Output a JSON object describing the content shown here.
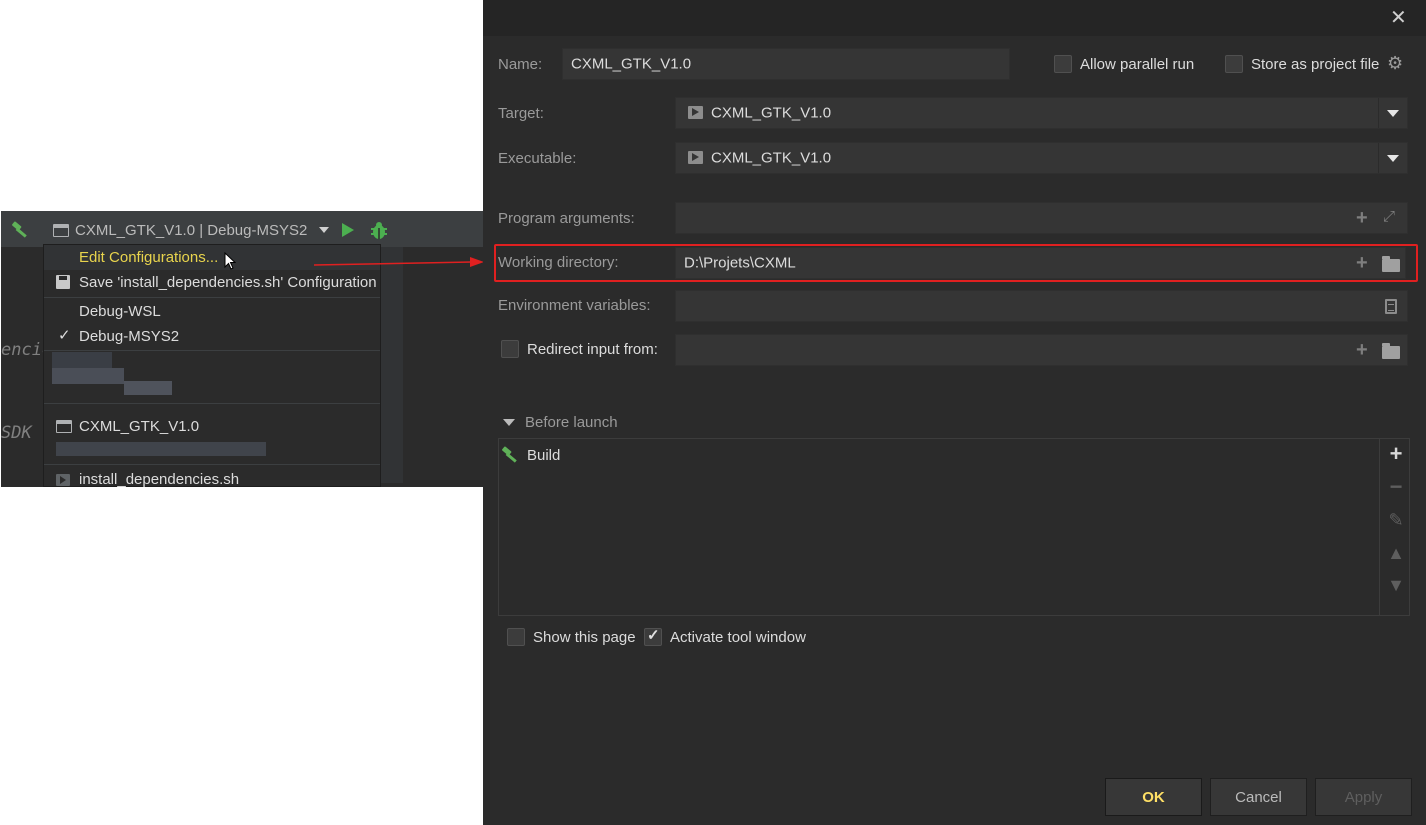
{
  "ide": {
    "run_config_label": "CXML_GTK_V1.0 | Debug-MSYS2",
    "code_fragment_1": "encie",
    "code_fragment_2": "SDK",
    "menu": {
      "edit_configurations": "Edit Configurations...",
      "save_configuration": "Save 'install_dependencies.sh' Configuration",
      "debug_wsl": "Debug-WSL",
      "debug_msys2": "Debug-MSYS2",
      "cxml_gtk": "CXML_GTK_V1.0",
      "install_dependencies": "install_dependencies.sh"
    }
  },
  "dialog": {
    "name_label": "Name:",
    "name_value": "CXML_GTK_V1.0",
    "allow_parallel_run": "Allow parallel run",
    "store_as_project_file": "Store as project file",
    "target_label": "Target:",
    "target_value": "CXML_GTK_V1.0",
    "executable_label": "Executable:",
    "executable_value": "CXML_GTK_V1.0",
    "program_arguments_label": "Program arguments:",
    "working_directory_label": "Working directory:",
    "working_directory_value": "D:\\Projets\\CXML",
    "environment_variables_label": "Environment variables:",
    "redirect_input_label": "Redirect input from:",
    "before_launch_label": "Before launch",
    "before_launch_items": [
      "Build"
    ],
    "show_this_page": "Show this page",
    "activate_tool_window": "Activate tool window",
    "buttons": {
      "ok": "OK",
      "cancel": "Cancel",
      "apply": "Apply"
    }
  },
  "colors": {
    "highlight": "#e02020",
    "accent": "#e8d44d",
    "ok": "#ffe066",
    "run_green": "#4caf50"
  }
}
